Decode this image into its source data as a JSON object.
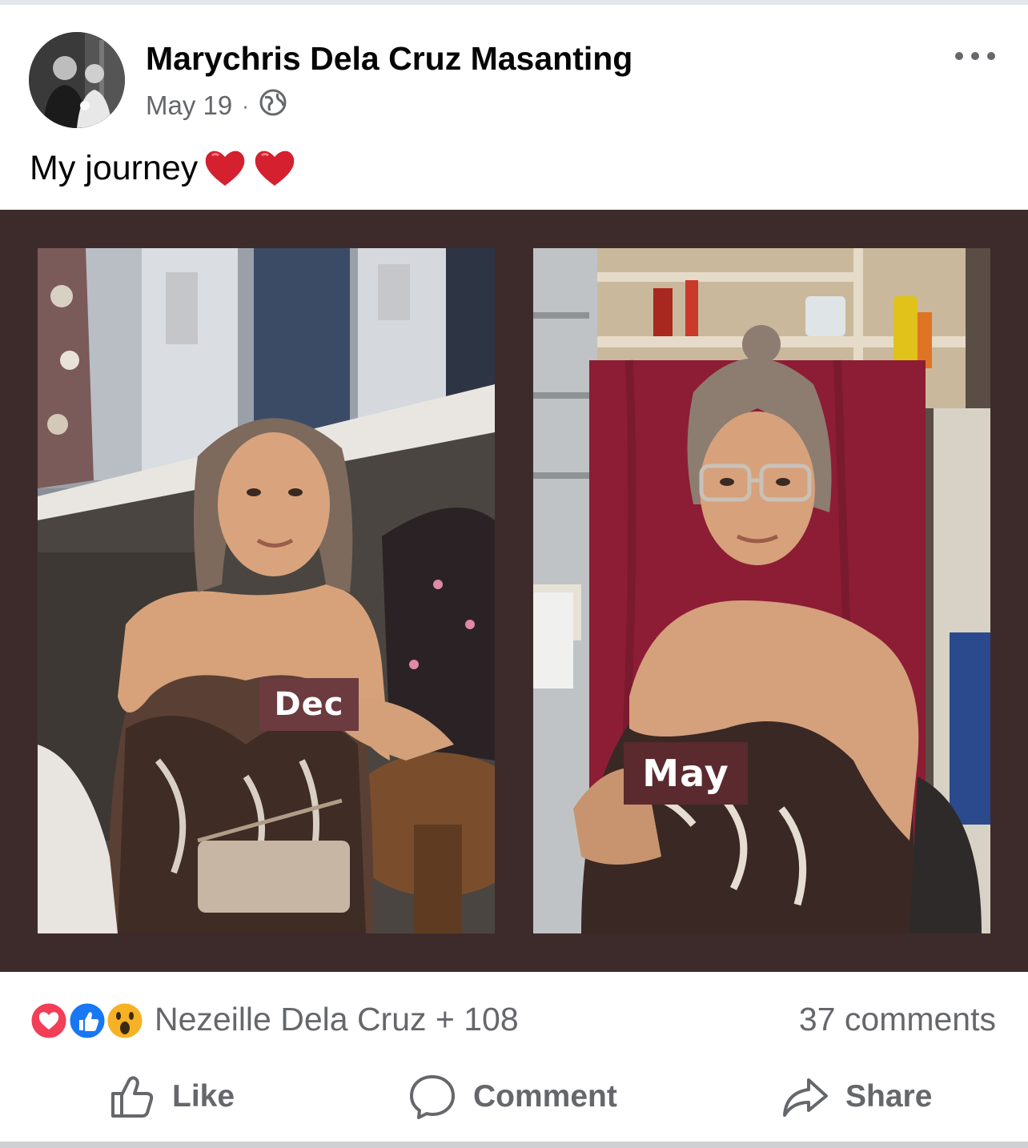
{
  "post": {
    "author": "Marychris Dela Cruz Masanting",
    "date": "May 19",
    "separator": "·",
    "privacy_icon": "globe-icon",
    "caption": "My journey",
    "caption_emoji": [
      "red-heart-icon",
      "red-heart-icon"
    ]
  },
  "collage": {
    "background": "#3d2b2b",
    "left_label": "Dec",
    "right_label": "May"
  },
  "reactions": {
    "icons": [
      "love-reaction-icon",
      "like-reaction-icon",
      "wow-reaction-icon"
    ],
    "reactors_text": "Nezeille Dela Cruz + 108",
    "comments_text": "37 comments"
  },
  "actions": {
    "like": "Like",
    "comment": "Comment",
    "share": "Share"
  },
  "colors": {
    "secondary_text": "#65676b",
    "love": "#f33e58",
    "like": "#1877f2",
    "wow": "#f7b125"
  }
}
